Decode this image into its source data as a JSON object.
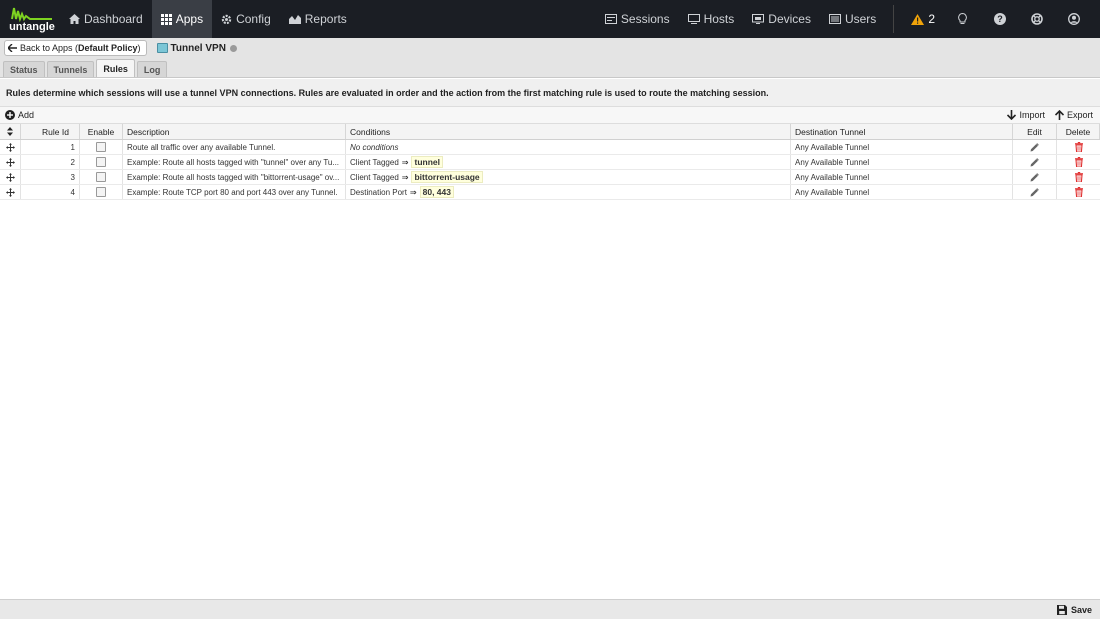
{
  "topnav": {
    "logo_text": "untangle",
    "items": [
      {
        "label": "Dashboard",
        "icon": "home-icon"
      },
      {
        "label": "Apps",
        "icon": "apps-grid-icon",
        "active": true
      },
      {
        "label": "Config",
        "icon": "gear-icon"
      },
      {
        "label": "Reports",
        "icon": "area-chart-icon"
      }
    ],
    "right_items": [
      {
        "label": "Sessions",
        "icon": "sessions-icon"
      },
      {
        "label": "Hosts",
        "icon": "hosts-icon"
      },
      {
        "label": "Devices",
        "icon": "devices-icon"
      },
      {
        "label": "Users",
        "icon": "users-icon"
      }
    ],
    "alert_count": "2",
    "alert_color": "#f0a30a"
  },
  "breadcrumb": {
    "back_prefix": "Back to Apps (",
    "back_policy": "Default Policy",
    "back_suffix": ")",
    "app_title": "Tunnel VPN"
  },
  "tabs": [
    {
      "label": "Status"
    },
    {
      "label": "Tunnels"
    },
    {
      "label": "Rules",
      "active": true
    },
    {
      "label": "Log"
    }
  ],
  "description": "Rules determine which sessions will use a tunnel VPN connections. Rules are evaluated in order and the action from the first matching rule is used to route the matching session.",
  "toolbar": {
    "add_label": "Add",
    "import_label": "Import",
    "export_label": "Export"
  },
  "grid": {
    "headers": {
      "rule_id": "Rule Id",
      "enable": "Enable",
      "description": "Description",
      "conditions": "Conditions",
      "destination": "Destination Tunnel",
      "edit": "Edit",
      "delete": "Delete"
    },
    "rows": [
      {
        "id": "1",
        "description": "Route all traffic over any available Tunnel.",
        "cond_text": "No conditions",
        "cond_italic": true,
        "cond_value": "",
        "destination": "Any Available Tunnel"
      },
      {
        "id": "2",
        "description": "Example: Route all hosts tagged with \"tunnel\" over any Tu...",
        "cond_text": "Client Tagged",
        "cond_italic": false,
        "cond_value": "tunnel",
        "destination": "Any Available Tunnel"
      },
      {
        "id": "3",
        "description": "Example: Route all hosts tagged with \"bittorrent-usage\" ov...",
        "cond_text": "Client Tagged",
        "cond_italic": false,
        "cond_value": "bittorrent-usage",
        "destination": "Any Available Tunnel"
      },
      {
        "id": "4",
        "description": "Example: Route TCP port 80 and port 443 over any Tunnel.",
        "cond_text": "Destination Port",
        "cond_italic": false,
        "cond_value": "80, 443",
        "destination": "Any Available Tunnel"
      }
    ]
  },
  "footer": {
    "save_label": "Save"
  },
  "colors": {
    "delete_icon": "#e03030",
    "logo_green": "#7ed321"
  }
}
